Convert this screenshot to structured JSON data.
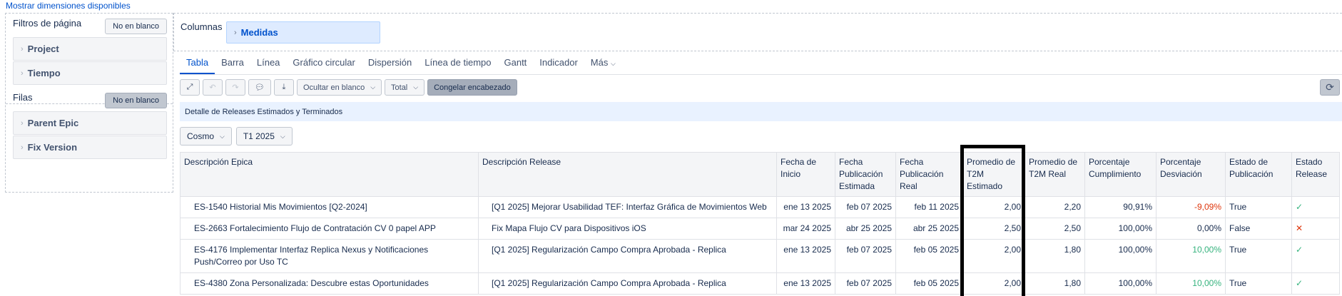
{
  "top_link": "Mostrar dimensiones disponibles",
  "left_panel": {
    "page_filters_label": "Filtros de página",
    "page_filters_button": "No en blanco",
    "page_dims": [
      "Project",
      "Tiempo"
    ],
    "rows_label": "Filas",
    "rows_button": "No en blanco",
    "row_dims": [
      "Parent Epic",
      "Fix Version"
    ]
  },
  "columns": {
    "label": "Columnas",
    "measures": "Medidas"
  },
  "tabs": [
    "Tabla",
    "Barra",
    "Línea",
    "Gráfico circular",
    "Dispersión",
    "Línea de tiempo",
    "Gantt",
    "Indicador",
    "Más"
  ],
  "toolbar": {
    "hide_blank": "Ocultar en blanco",
    "total": "Total",
    "freeze_header": "Congelar encabezado"
  },
  "report_title": "Detalle de Releases Estimados y Terminados",
  "selects": [
    "Cosmo",
    "T1 2025"
  ],
  "table": {
    "headers": [
      "Descripción Epica",
      "Descripción Release",
      "Fecha de Inicio",
      "Fecha Publicación Estimada",
      "Fecha Publicación Real",
      "Promedio de T2M Estimado",
      "Promedio de T2M Real",
      "Porcentaje Cumplimiento",
      "Porcentaje Desviación",
      "Estado de Publicación",
      "Estado Release"
    ],
    "rows": [
      {
        "epic": "ES-1540 Historial Mis Movimientos [Q2-2024]",
        "release": "[Q1 2025] Mejorar Usabilidad TEF: Interfaz Gráfica de Movimientos Web",
        "start": "ene 13 2025",
        "est_pub": "feb 07 2025",
        "real_pub": "feb 11 2025",
        "t2m_est": "2,00",
        "t2m_real": "2,20",
        "compliance": "90,91%",
        "deviation": "-9,09%",
        "dev_sign": "neg",
        "pub_state": "True",
        "release_state": "check"
      },
      {
        "epic": "ES-2663 Fortalecimiento Flujo de Contratación CV 0 papel APP",
        "release": "Fix Mapa Flujo CV para Dispositivos iOS",
        "start": "mar 24 2025",
        "est_pub": "abr 25 2025",
        "real_pub": "abr 25 2025",
        "t2m_est": "2,50",
        "t2m_real": "2,50",
        "compliance": "100,00%",
        "deviation": "0,00%",
        "dev_sign": "zero",
        "pub_state": "False",
        "release_state": "cross"
      },
      {
        "epic": "ES-4176 Implementar Interfaz Replica Nexus y Notificaciones Push/Correo por Uso TC",
        "release": "[Q1 2025] Regularización Campo Compra Aprobada - Replica",
        "start": "ene 13 2025",
        "est_pub": "feb 07 2025",
        "real_pub": "feb 05 2025",
        "t2m_est": "2,00",
        "t2m_real": "1,80",
        "compliance": "100,00%",
        "deviation": "10,00%",
        "dev_sign": "pos",
        "pub_state": "True",
        "release_state": "check"
      },
      {
        "epic": "ES-4380 Zona Personalizada: Descubre estas Oportunidades",
        "release": "[Q1 2025] Regularización Campo Compra Aprobada - Replica",
        "start": "ene 13 2025",
        "est_pub": "feb 07 2025",
        "real_pub": "feb 05 2025",
        "t2m_est": "2,00",
        "t2m_real": "1,80",
        "compliance": "100,00%",
        "deviation": "10,00%",
        "dev_sign": "pos",
        "pub_state": "True",
        "release_state": "check"
      }
    ]
  },
  "colors": {
    "accent": "#0052cc",
    "negative": "#de350b",
    "positive": "#36b37e",
    "header_bg": "#f4f5f7",
    "title_bar_bg": "#e9f2ff"
  }
}
